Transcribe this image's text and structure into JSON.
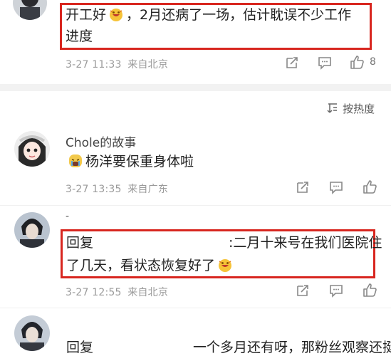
{
  "comment1": {
    "text_line1_a": "开工好",
    "text_line1_b": "，2月还病了一场，估计耽误不少工作",
    "text_line2": "进度",
    "time": "3-27 11:33",
    "location": "来自北京",
    "like_count": "8"
  },
  "sort": {
    "label": "按热度"
  },
  "comment2": {
    "username": "Chole的故事",
    "text": "杨洋要保重身体啦",
    "time": "3-27 13:35",
    "location": "来自广东"
  },
  "comment3": {
    "username_fragment": "-",
    "text_line1_a": "回复",
    "text_line1_b": ":二月十来号在我们医院住",
    "text_line2": "了几天，看状态恢复好了",
    "time": "3-27 12:55",
    "location": "来自北京"
  },
  "comment4": {
    "text_a": "回复",
    "text_b": "一个多月还有呀，那粉丝观察还挺"
  },
  "colors": {
    "highlight_border": "#d8261f",
    "meta_gray": "#9a9a9a",
    "divider": "#f2f2f2"
  }
}
